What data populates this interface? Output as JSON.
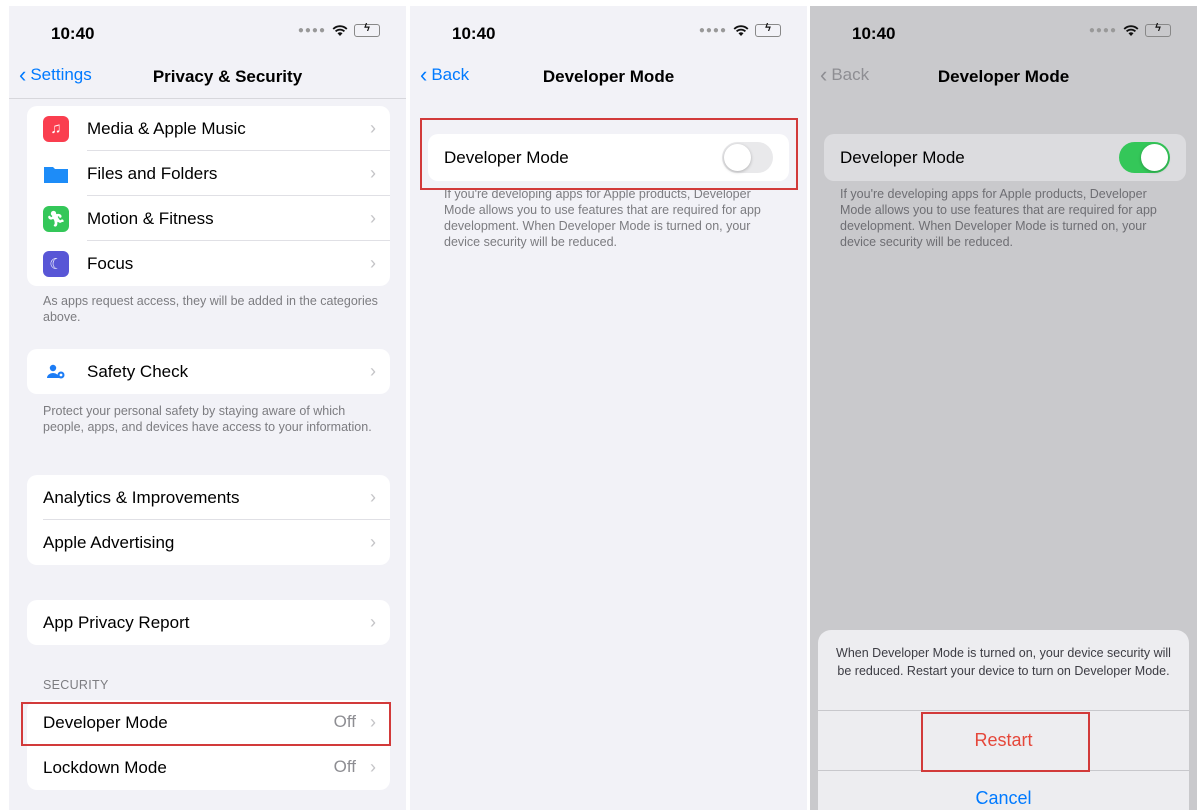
{
  "screens": [
    {
      "status": {
        "time": "10:40"
      },
      "nav": {
        "back_label": "Settings",
        "title": "Privacy & Security"
      },
      "group1": [
        {
          "label": "Media & Apple Music",
          "icon": "music-icon",
          "color": "#fa3e4f"
        },
        {
          "label": "Files and Folders",
          "icon": "folder-icon",
          "color": "#1d8cf8"
        },
        {
          "label": "Motion & Fitness",
          "icon": "running-icon",
          "color": "#34c759"
        },
        {
          "label": "Focus",
          "icon": "moon-icon",
          "color": "#5856d6"
        }
      ],
      "group1_footer": "As apps request access, they will be added in the categories above.",
      "group2": [
        {
          "label": "Safety Check",
          "icon": "people-icon",
          "color": "#1c7cf5"
        }
      ],
      "group2_footer": "Protect your personal safety by staying aware of which people, apps, and devices have access to your information.",
      "group3": [
        {
          "label": "Analytics & Improvements"
        },
        {
          "label": "Apple Advertising"
        }
      ],
      "group4": [
        {
          "label": "App Privacy Report"
        }
      ],
      "security_header": "SECURITY",
      "group5": [
        {
          "label": "Developer Mode",
          "value": "Off"
        },
        {
          "label": "Lockdown Mode",
          "value": "Off"
        }
      ]
    },
    {
      "status": {
        "time": "10:40"
      },
      "nav": {
        "back_label": "Back",
        "title": "Developer Mode"
      },
      "toggle_row": {
        "label": "Developer Mode",
        "state": "off"
      },
      "footer": "If you're developing apps for Apple products, Developer Mode allows you to use features that are required for app development. When Developer Mode is turned on, your device security will be reduced."
    },
    {
      "status": {
        "time": "10:40"
      },
      "nav": {
        "back_label": "Back",
        "title": "Developer Mode"
      },
      "toggle_row": {
        "label": "Developer Mode",
        "state": "on"
      },
      "footer": "If you're developing apps for Apple products, Developer Mode allows you to use features that are required for app development. When Developer Mode is turned on, your device security will be reduced.",
      "sheet": {
        "message": "When Developer Mode is turned on, your device security will be reduced. Restart your device to turn on Developer Mode.",
        "restart_label": "Restart",
        "cancel_label": "Cancel"
      }
    }
  ],
  "colors": {
    "accent": "#007aff",
    "toggle_on": "#34c759",
    "destructive": "#ff3b30",
    "highlight": "#d23a3a"
  }
}
